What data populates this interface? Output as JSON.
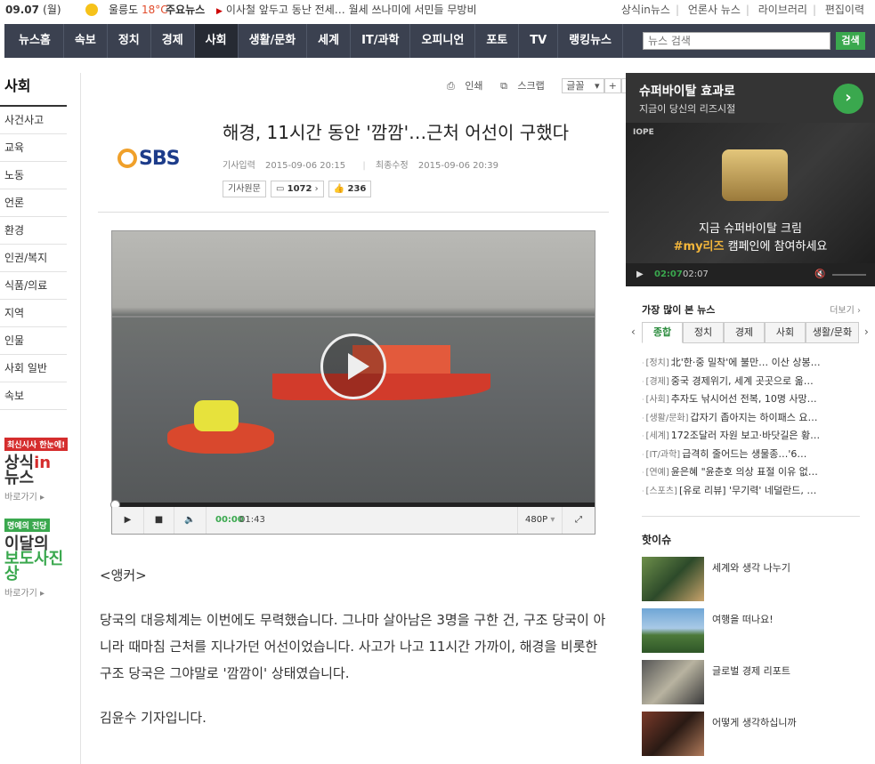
{
  "topbar": {
    "date": "09.07",
    "weekday": "(월)",
    "weather_place": "울릉도",
    "weather_temp": "18°C",
    "major_label": "주요뉴스",
    "ticker": "이사철 앞두고 동난 전세… 월세 쓰나미에 서민들 무방비",
    "links": [
      "상식in뉴스",
      "언론사 뉴스",
      "라이브러리",
      "편집이력"
    ]
  },
  "nav": {
    "items": [
      "뉴스홈",
      "속보",
      "정치",
      "경제",
      "사회",
      "생활/문화",
      "세계",
      "IT/과학",
      "오피니언",
      "포토",
      "TV",
      "랭킹뉴스"
    ],
    "active": "사회",
    "search_placeholder": "뉴스 검색",
    "search_button": "검색"
  },
  "left": {
    "heading": "사회",
    "items": [
      "사건사고",
      "교육",
      "노동",
      "언론",
      "환경",
      "인권/복지",
      "식품/의료",
      "지역",
      "인물",
      "사회 일반",
      "속보"
    ],
    "promo1_tag": "최신시사 한눈에!",
    "promo1_line1": "상식",
    "promo1_line1b": "in",
    "promo1_line2": "뉴스",
    "promo1_more": "바로가기 ▸",
    "promo2_tag": "명예의 전당",
    "promo2_line1": "이달의",
    "promo2_line2": "보도사진상",
    "promo2_more": "바로가기 ▸"
  },
  "article": {
    "tools": {
      "print": "인쇄",
      "scrap": "스크랩",
      "font": "글꼴",
      "plus": "+",
      "minus": "-"
    },
    "press_logo": "SBS",
    "title": "해경, 11시간 동안 '깜깜'…근처 어선이 구했다",
    "input_label": "기사입력",
    "input_time": "2015-09-06 20:15",
    "modified_label": "최종수정",
    "modified_time": "2015-09-06 20:39",
    "original_button": "기사원문",
    "comment_count": "1072",
    "like_count": "236",
    "player": {
      "current": "00:00",
      "duration": "01:43",
      "quality": "480P",
      "progress": 0
    },
    "paragraphs": [
      "<앵커>",
      "당국의 대응체계는 이번에도 무력했습니다. 그나마 살아남은 3명을 구한 건, 구조 당국이 아니라 때마침 근처를 지나가던 어선이었습니다. 사고가 나고 11시간 가까이, 해경을 비롯한 구조 당국은 그야말로 '깜깜이' 상태였습니다.",
      "김윤수 기자입니다."
    ]
  },
  "ad": {
    "headline": "슈퍼바이탈 효과로",
    "sub": "지금이 당신의 리즈시절",
    "brand": "IOPE",
    "msg1": "지금 슈퍼바이탈 크림",
    "msg2_hl": "#my리즈",
    "msg2_rest": " 캠페인에 참여하세요",
    "time_current": "02:07",
    "time_total": "02:07"
  },
  "popular": {
    "heading": "가장 많이 본 뉴스",
    "more": "더보기",
    "tabs": [
      "종합",
      "정치",
      "경제",
      "사회",
      "생활/문화"
    ],
    "active_tab": "종합",
    "items": [
      {
        "cat": "[정치]",
        "text": "北'한·중 밀착'에 불만… 이산 상봉…"
      },
      {
        "cat": "[경제]",
        "text": "중국 경제위기, 세계 곳곳으로 옮…"
      },
      {
        "cat": "[사회]",
        "text": "추자도 낚시어선 전복, 10명 사망…"
      },
      {
        "cat": "[생활/문화]",
        "text": "갑자기 좁아지는 하이패스 요…"
      },
      {
        "cat": "[세계]",
        "text": "172조달러 자원 보고·바닷길은 황…"
      },
      {
        "cat": "[IT/과학]",
        "text": "급격히 줄어드는 생물종…'6…"
      },
      {
        "cat": "[연예]",
        "text": "윤은혜 \"윤춘호 의상 표절 이유 없…"
      },
      {
        "cat": "[스포츠]",
        "text": "[유로 리뷰] '무기력' 네덜란드, …"
      }
    ]
  },
  "hot_issue": {
    "heading": "핫이슈",
    "items": [
      "세계와 생각 나누기",
      "여행을 떠나요!",
      "글로벌 경제 리포트",
      "어떻게 생각하십니까"
    ]
  }
}
